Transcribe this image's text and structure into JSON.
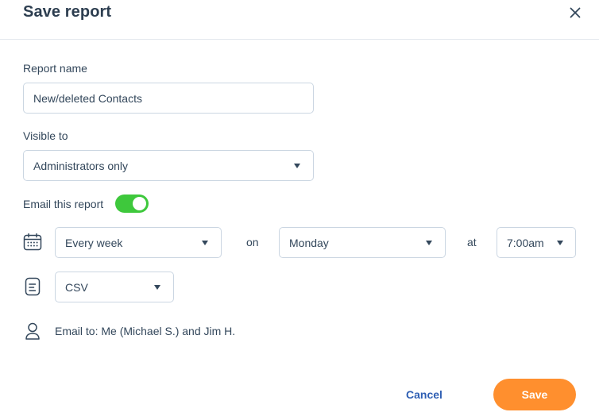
{
  "dialog": {
    "title": "Save report",
    "close_icon": "close-icon"
  },
  "report_name": {
    "label": "Report name",
    "value": "New/deleted Contacts"
  },
  "visible_to": {
    "label": "Visible to",
    "selected": "Administrators only"
  },
  "email_toggle": {
    "label": "Email this report",
    "on": true,
    "color_on": "#3ec83c"
  },
  "schedule": {
    "icon": "calendar-icon",
    "frequency": "Every week",
    "on_text": "on",
    "day": "Monday",
    "at_text": "at",
    "time": "7:00am"
  },
  "format": {
    "icon": "document-icon",
    "selected": "CSV"
  },
  "recipients": {
    "icon": "person-icon",
    "text": "Email to: Me (Michael S.) and Jim H."
  },
  "actions": {
    "cancel_label": "Cancel",
    "save_label": "Save",
    "save_color": "#ff8f2e",
    "cancel_color": "#2f5fb3"
  }
}
